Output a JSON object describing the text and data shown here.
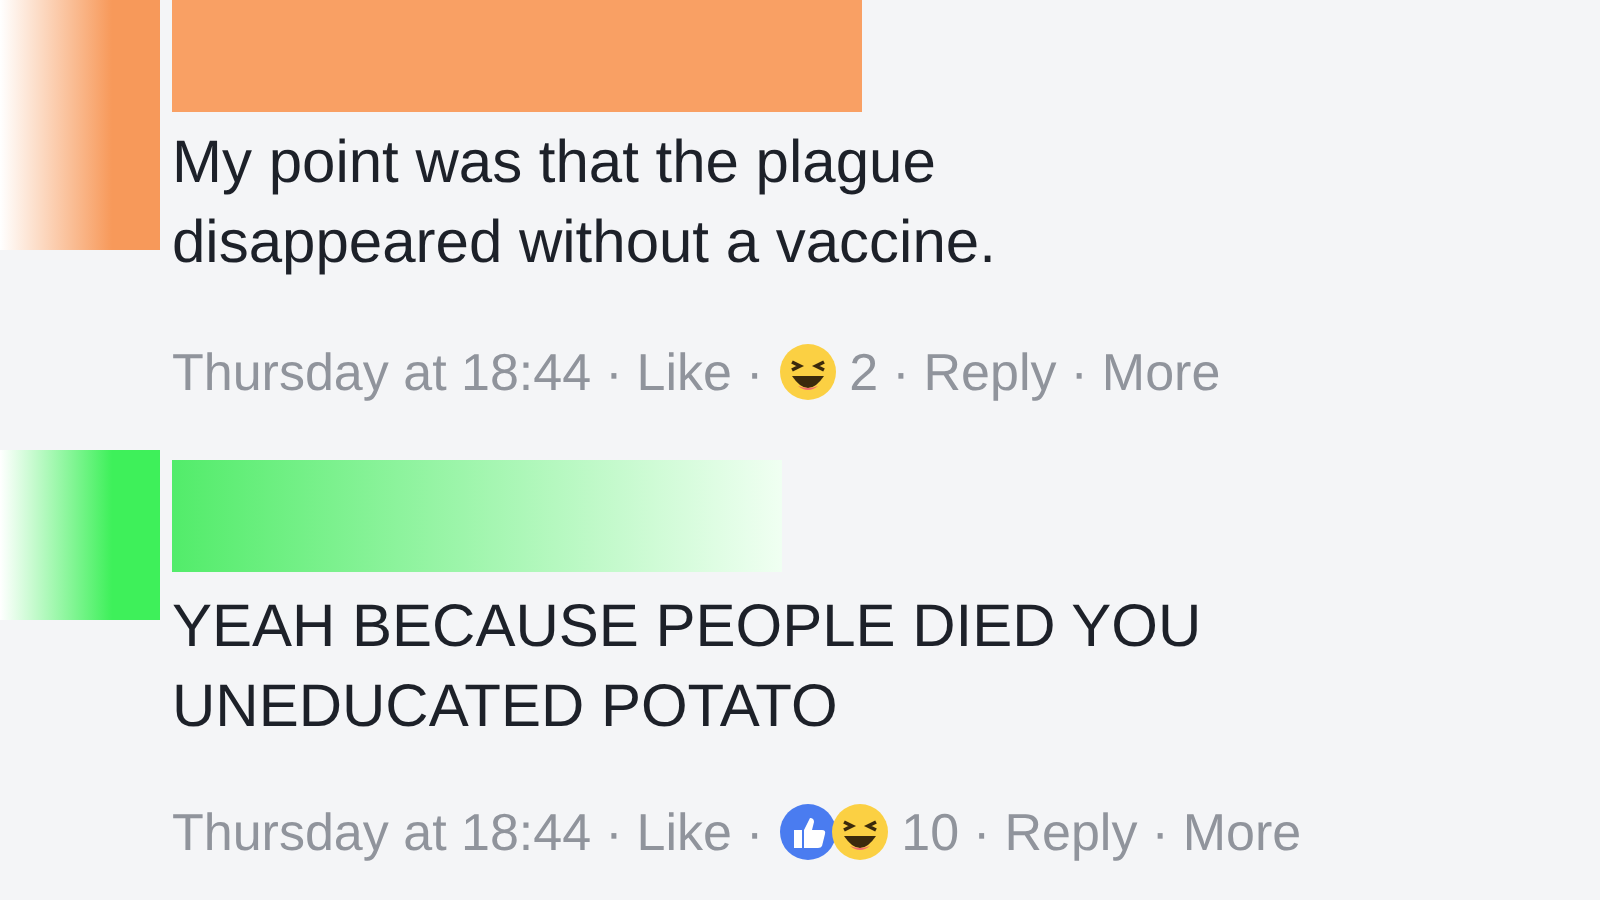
{
  "comments": [
    {
      "avatar": {
        "color": "#f7995a"
      },
      "name_block": {
        "color": "#f9a064"
      },
      "text": "My point was that the plague disappeared without a vaccine.",
      "meta": [
        {
          "kind": "text",
          "text": "Thursday at 18:44"
        },
        {
          "kind": "sep",
          "text": "·"
        },
        {
          "kind": "link",
          "text": "Like"
        },
        {
          "kind": "sep",
          "text": "·"
        },
        {
          "kind": "reactions",
          "reactions": [
            {
              "kind": "haha"
            }
          ],
          "count": "2"
        },
        {
          "kind": "sep",
          "text": "·"
        },
        {
          "kind": "link",
          "text": "Reply"
        },
        {
          "kind": "sep",
          "text": "·"
        },
        {
          "kind": "link",
          "text": "More"
        }
      ]
    },
    {
      "avatar": {
        "color": "#3ef05a"
      },
      "name_block": {
        "color": "#52ec6a"
      },
      "text": "YEAH BECAUSE PEOPLE DIED YOU UNEDUCATED POTATO",
      "meta": [
        {
          "kind": "text",
          "text": "Thursday at 18:44"
        },
        {
          "kind": "sep",
          "text": "·"
        },
        {
          "kind": "link",
          "text": "Like"
        },
        {
          "kind": "sep",
          "text": "·"
        },
        {
          "kind": "reactions",
          "reactions": [
            {
              "kind": "like"
            },
            {
              "kind": "haha"
            }
          ],
          "count": "10"
        },
        {
          "kind": "sep",
          "text": "·"
        },
        {
          "kind": "link",
          "text": "Reply"
        },
        {
          "kind": "sep",
          "text": "·"
        },
        {
          "kind": "link",
          "text": "More"
        }
      ]
    }
  ]
}
